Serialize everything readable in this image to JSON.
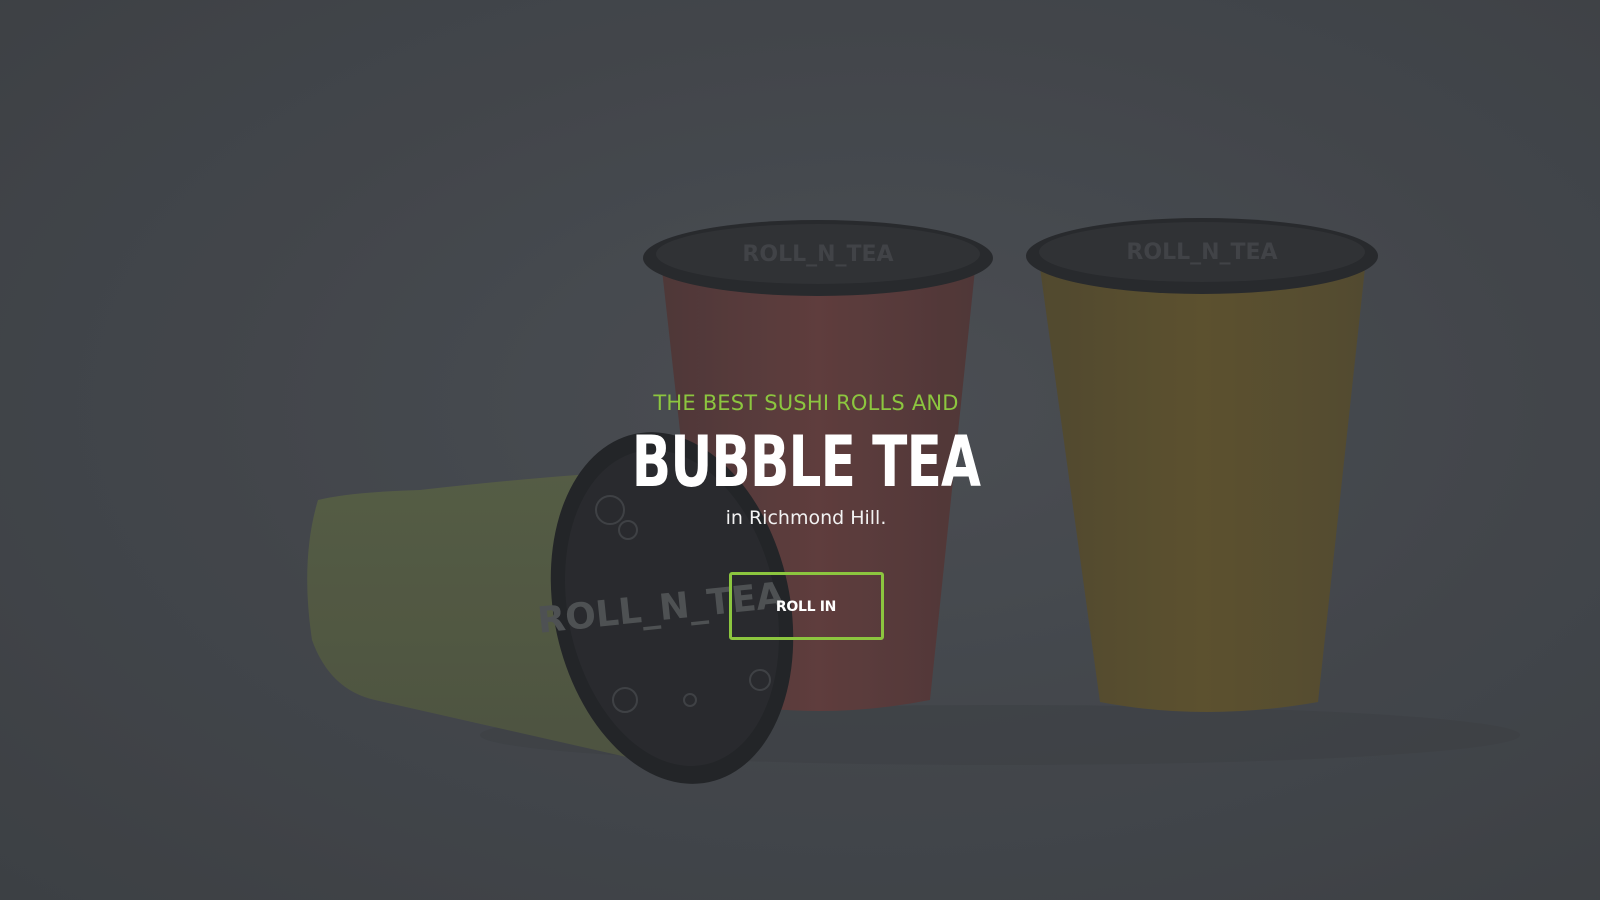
{
  "hero": {
    "kicker": "THE BEST SUSHI ROLLS AND",
    "title": "BUBBLE TEA",
    "subtitle": "in Richmond Hill.",
    "cta_label": "ROLL IN",
    "cup_logo": "ROLL N TEA"
  },
  "colors": {
    "accent": "#8cc63f",
    "background": "#4c4f55",
    "title": "#ffffff"
  },
  "images": {
    "background_photo": "three bubble tea cups (green, red, orange) with sealed black lids"
  }
}
